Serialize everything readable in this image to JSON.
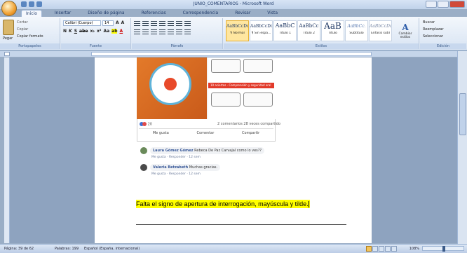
{
  "window": {
    "title": "JUNIO_COMENTARIOS - Microsoft Word"
  },
  "tabs": [
    "Inicio",
    "Insertar",
    "Diseño de página",
    "Referencias",
    "Correspondencia",
    "Revisar",
    "Vista"
  ],
  "clipboard": {
    "paste": "Pegar",
    "cut": "Cortar",
    "copy": "Copiar",
    "format_painter": "Copiar formato",
    "label": "Portapapeles"
  },
  "font": {
    "name": "Calibri (Cuerpo)",
    "size": "14",
    "label": "Fuente"
  },
  "paragraph": {
    "label": "Párrafo"
  },
  "styles": {
    "items": [
      {
        "sample": "AaBbCcDc",
        "label": "¶ Normal"
      },
      {
        "sample": "AaBbCcDc",
        "label": "¶ Sin espa..."
      },
      {
        "sample": "AaBbC",
        "label": "Título 1"
      },
      {
        "sample": "AaBbCc",
        "label": "Título 2"
      },
      {
        "sample": "AaB",
        "label": "Título"
      },
      {
        "sample": "AaBbCc.",
        "label": "Subtítulo"
      },
      {
        "sample": "AaBbCcDc",
        "label": "Énfasis sutil"
      }
    ],
    "change": "Cambiar estilos",
    "label": "Estilos"
  },
  "editing": {
    "find": "Buscar",
    "replace": "Reemplazar",
    "select": "Seleccionar",
    "label": "Edición"
  },
  "post": {
    "image_caption": "10 aciertos - Comprensión y seguridad oral",
    "reactions_count": "20",
    "stats": "2 comentarios  28 veces compartido",
    "like": "Me gusta",
    "comment": "Comentar",
    "share": "Compartir",
    "comments": [
      {
        "name": "Laura Gómez Gómez",
        "text": "Rebeca De Paz Carvajal como lo ves??",
        "meta": "Me gusta · Responder · 12 sem"
      },
      {
        "name": "Valeria Betzabeth",
        "text": "Muchas gracias.",
        "meta": "Me gusta · Responder · 12 sem"
      }
    ]
  },
  "document": {
    "highlighted_text": "Falta el signo de apertura de interrogación, mayúscula y tilde."
  },
  "status": {
    "page": "Página: 39 de 62",
    "words": "Palabras: 199",
    "language": "Español (España, internacional)",
    "zoom": "108%"
  },
  "colors": {
    "highlight": "#ffff00",
    "accent": "#2a5aa8",
    "ribbon_bg": "#d8e4f3"
  }
}
